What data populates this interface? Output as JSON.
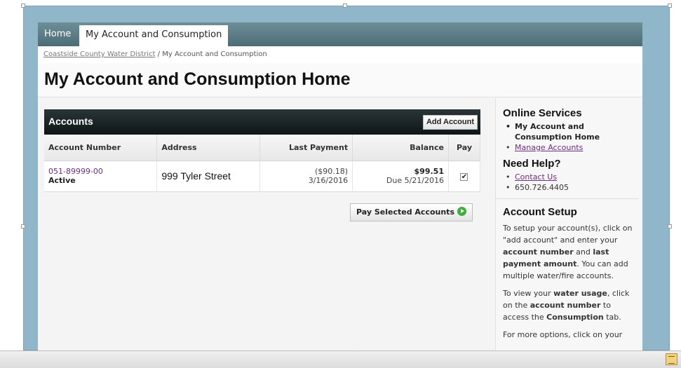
{
  "nav": {
    "home": "Home",
    "tab": "My Account and Consumption"
  },
  "breadcrumb": {
    "link": "Coastside County Water District",
    "separator": " / ",
    "current": "My Account and Consumption"
  },
  "page_title": "My Account and Consumption Home",
  "accounts": {
    "title": "Accounts",
    "add_button": "Add Account",
    "columns": [
      "Account Number",
      "Address",
      "Last Payment",
      "Balance",
      "Pay"
    ],
    "rows": [
      {
        "account_number": "051-89999-00",
        "status": "Active",
        "address": "999 Tyler Street",
        "last_payment_amount": "($90.18)",
        "last_payment_date": "3/16/2016",
        "balance": "$99.51",
        "due": "Due 5/21/2016",
        "pay_checked": true
      }
    ],
    "pay_button": "Pay Selected Accounts"
  },
  "sidebar": {
    "online_services": {
      "heading": "Online Services",
      "items": [
        "My Account and Consumption Home",
        "Manage Accounts"
      ]
    },
    "need_help": {
      "heading": "Need Help?",
      "contact_link": "Contact Us",
      "phone": "650.726.4405"
    },
    "account_setup": {
      "heading": "Account Setup",
      "p1": [
        "To setup your account(s), click on \"add account\" and enter your ",
        "account number",
        " and ",
        "last payment amount",
        ".  You can add multiple water/fire accounts."
      ],
      "p2": [
        "To view your ",
        "water usage",
        ", click on the ",
        "account number",
        " to access the ",
        "Consumption",
        " tab."
      ],
      "p3": "For more options, click on your"
    }
  },
  "colors": {
    "nav_bg": "#5b7b85",
    "accounts_header": "#1a2426",
    "link": "#6b2d7f",
    "frame": "#8fb6c9"
  }
}
